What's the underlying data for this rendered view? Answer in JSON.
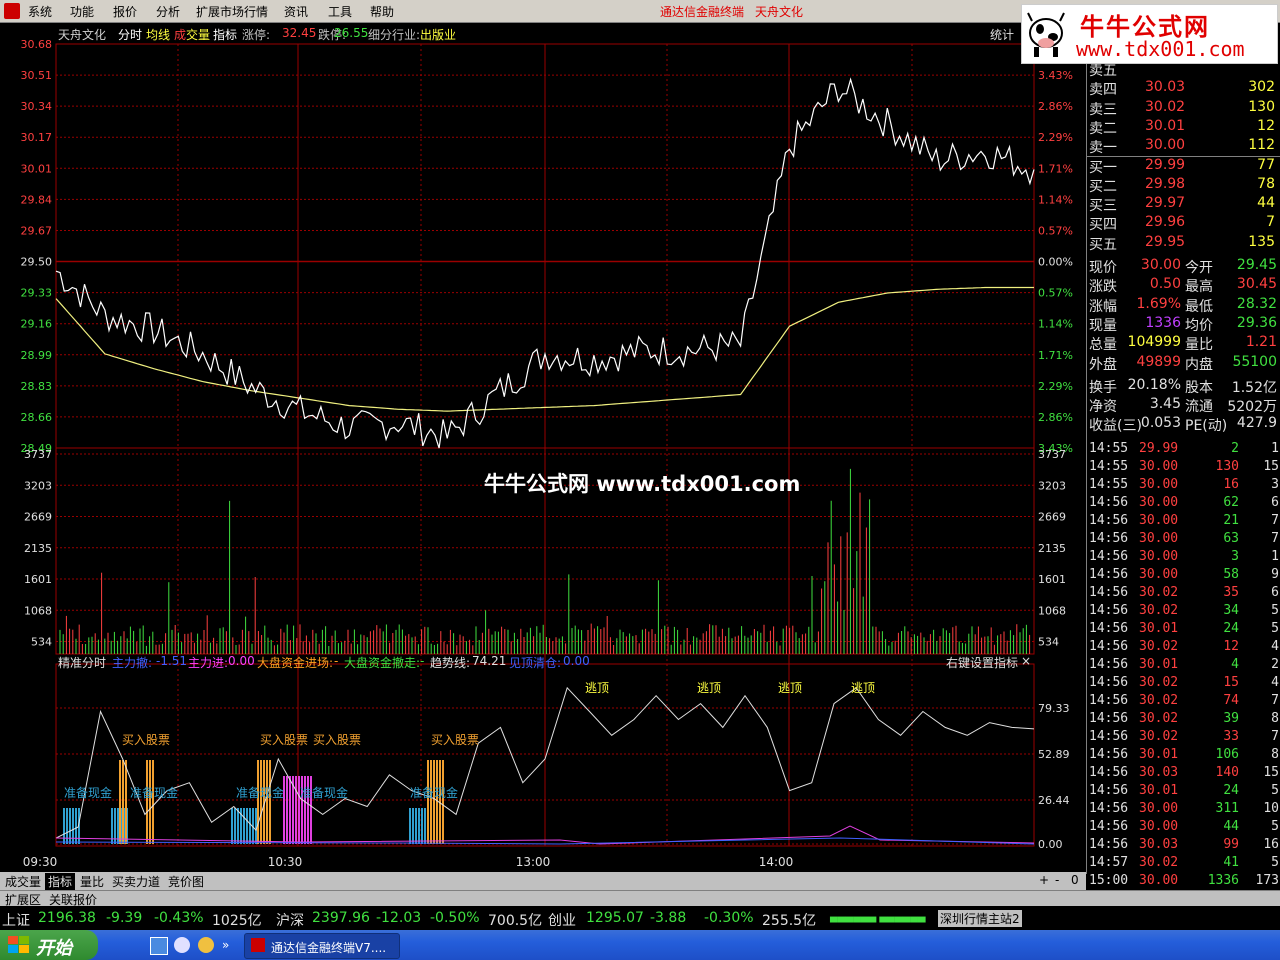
{
  "menu": {
    "items": [
      "系统",
      "功能",
      "报价",
      "分析",
      "扩展市场行情",
      "资讯",
      "工具",
      "帮助"
    ],
    "center_title": "通达信金融终端",
    "stock_name": "天舟文化"
  },
  "ad": {
    "brand": "牛牛公式网",
    "url": "www.tdx001.com"
  },
  "header": {
    "stock": "天舟文化",
    "tab_fenshi": "分时",
    "tab_junxian": "均线",
    "tab_cheng": "成",
    "tab_jiaoliang": "交量",
    "tab_zhibiao": "指标",
    "zhangting_label": "涨停:",
    "zhangting_value": "32.45",
    "dieting_label": "跌停:",
    "dieting_value": "26.55",
    "industry_label": "细分行业:",
    "industry_value": "出版业",
    "stats_button": "统计"
  },
  "colors": {
    "up": "#ff4040",
    "down": "#40e040",
    "grid": "#9a0000",
    "price_line": "#ffffff",
    "avg_line": "#f0f080",
    "yellow": "#ffff40"
  },
  "price_axis": {
    "left": [
      "30.68",
      "30.51",
      "30.34",
      "30.17",
      "30.01",
      "29.84",
      "29.67",
      "29.50",
      "29.33",
      "29.16",
      "28.99",
      "28.83",
      "28.66",
      "28.49"
    ],
    "right": [
      "3.43%",
      "2.86%",
      "2.29%",
      "1.71%",
      "1.14%",
      "0.57%",
      "0.00%",
      "0.57%",
      "1.14%",
      "1.71%",
      "2.29%",
      "2.86%",
      "3.43%"
    ]
  },
  "volume_axis": [
    "3737",
    "3203",
    "2669",
    "2135",
    "1601",
    "1068",
    "534"
  ],
  "indicator_header": {
    "name": "精准分时",
    "zlq_label": "主力撤:",
    "zlq_value": "-1.51",
    "zlj_label": "主力进:",
    "zlj_value": "0.00",
    "dpjc_label": "大盘资金进场:",
    "dpjc_value": "-",
    "dpcz_label": "大盘资金撤走:",
    "dpcz_value": "-",
    "qsx_label": "趋势线:",
    "qsx_value": "74.21",
    "jdqc_label": "见顶清仓:",
    "jdqc_value": "0.00",
    "settings": "右键设置指标",
    "close": "×"
  },
  "indicator_axis": [
    "79.33",
    "52.89",
    "26.44",
    "0.00"
  ],
  "signals": {
    "buy": "买入股票",
    "cash": "准备现金",
    "top": "逃顶"
  },
  "time_axis": [
    "09:30",
    "10:30",
    "13:00",
    "14:00"
  ],
  "chart_data": {
    "type": "line",
    "title": "",
    "x": [
      "09:30",
      "10:30",
      "13:00",
      "14:00",
      "15:00"
    ],
    "prev_close": 29.5,
    "ylim": [
      28.49,
      30.68
    ],
    "series": [
      {
        "name": "",
        "values": [
          29.45,
          29.21,
          29.13,
          29.0,
          28.82,
          28.69,
          28.6,
          28.63,
          28.55,
          28.78,
          29.0,
          28.97,
          29.02,
          29.02,
          29.05,
          30.12,
          30.45,
          30.25,
          30.05,
          30.1,
          30.0
        ]
      },
      {
        "name": "均线",
        "values": [
          29.3,
          29.0,
          28.92,
          28.85,
          28.8,
          28.76,
          28.72,
          28.7,
          28.69,
          28.7,
          28.71,
          28.72,
          28.74,
          28.76,
          28.78,
          29.15,
          29.28,
          29.33,
          29.35,
          29.36,
          29.36
        ]
      }
    ]
  },
  "right_panel": {
    "order_book": [
      {
        "label": "卖五",
        "price": "",
        "vol": ""
      },
      {
        "label": "卖四",
        "price": "30.03",
        "vol": "302"
      },
      {
        "label": "卖三",
        "price": "30.02",
        "vol": "130"
      },
      {
        "label": "卖二",
        "price": "30.01",
        "vol": "12"
      },
      {
        "label": "卖一",
        "price": "30.00",
        "vol": "112"
      },
      {
        "label": "买一",
        "price": "29.99",
        "vol": "77"
      },
      {
        "label": "买二",
        "price": "29.98",
        "vol": "78"
      },
      {
        "label": "买三",
        "price": "29.97",
        "vol": "44"
      },
      {
        "label": "买四",
        "price": "29.96",
        "vol": "7"
      },
      {
        "label": "买五",
        "price": "29.95",
        "vol": "135"
      }
    ],
    "quote": [
      {
        "l1": "现价",
        "v1": "30.00",
        "c1": "#ff4040",
        "l2": "今开",
        "v2": "29.45",
        "c2": "#40e040"
      },
      {
        "l1": "涨跌",
        "v1": "0.50",
        "c1": "#ff4040",
        "l2": "最高",
        "v2": "30.45",
        "c2": "#ff4040"
      },
      {
        "l1": "涨幅",
        "v1": "1.69%",
        "c1": "#ff4040",
        "l2": "最低",
        "v2": "28.32",
        "c2": "#40e040"
      },
      {
        "l1": "现量",
        "v1": "1336",
        "c1": "#c040ff",
        "l2": "均价",
        "v2": "29.36",
        "c2": "#40e040"
      },
      {
        "l1": "总量",
        "v1": "104999",
        "c1": "#ffff40",
        "l2": "量比",
        "v2": "1.21",
        "c2": "#ff4040"
      },
      {
        "l1": "外盘",
        "v1": "49899",
        "c1": "#ff4040",
        "l2": "内盘",
        "v2": "55100",
        "c2": "#40e040"
      }
    ],
    "fundamentals": [
      {
        "l1": "换手",
        "v1": "20.18%",
        "l2": "股本",
        "v2": "1.52亿"
      },
      {
        "l1": "净资",
        "v1": "3.45",
        "l2": "流通",
        "v2": "5202万"
      },
      {
        "l1": "收益(三)",
        "v1": "0.053",
        "l2": "PE(动)",
        "v2": "427.9"
      }
    ],
    "ticks": [
      {
        "t": "14:55",
        "p": "29.99",
        "v": "2",
        "n": "1",
        "up": false
      },
      {
        "t": "14:55",
        "p": "30.00",
        "v": "130",
        "n": "15",
        "up": true
      },
      {
        "t": "14:55",
        "p": "30.00",
        "v": "16",
        "n": "3",
        "up": true
      },
      {
        "t": "14:56",
        "p": "30.00",
        "v": "62",
        "n": "6",
        "up": false
      },
      {
        "t": "14:56",
        "p": "30.00",
        "v": "21",
        "n": "7",
        "up": false
      },
      {
        "t": "14:56",
        "p": "30.00",
        "v": "63",
        "n": "7",
        "up": false
      },
      {
        "t": "14:56",
        "p": "30.00",
        "v": "3",
        "n": "1",
        "up": false
      },
      {
        "t": "14:56",
        "p": "30.00",
        "v": "58",
        "n": "9",
        "up": false
      },
      {
        "t": "14:56",
        "p": "30.02",
        "v": "35",
        "n": "6",
        "up": true
      },
      {
        "t": "14:56",
        "p": "30.02",
        "v": "34",
        "n": "5",
        "up": false
      },
      {
        "t": "14:56",
        "p": "30.01",
        "v": "24",
        "n": "5",
        "up": false
      },
      {
        "t": "14:56",
        "p": "30.02",
        "v": "12",
        "n": "4",
        "up": true
      },
      {
        "t": "14:56",
        "p": "30.01",
        "v": "4",
        "n": "2",
        "up": false
      },
      {
        "t": "14:56",
        "p": "30.02",
        "v": "15",
        "n": "4",
        "up": true
      },
      {
        "t": "14:56",
        "p": "30.02",
        "v": "74",
        "n": "7",
        "up": true
      },
      {
        "t": "14:56",
        "p": "30.02",
        "v": "39",
        "n": "8",
        "up": false
      },
      {
        "t": "14:56",
        "p": "30.02",
        "v": "33",
        "n": "7",
        "up": true
      },
      {
        "t": "14:56",
        "p": "30.01",
        "v": "106",
        "n": "8",
        "up": false
      },
      {
        "t": "14:56",
        "p": "30.03",
        "v": "140",
        "n": "15",
        "up": true
      },
      {
        "t": "14:56",
        "p": "30.01",
        "v": "24",
        "n": "5",
        "up": false
      },
      {
        "t": "14:56",
        "p": "30.00",
        "v": "311",
        "n": "10",
        "up": false
      },
      {
        "t": "14:56",
        "p": "30.00",
        "v": "44",
        "n": "5",
        "up": false
      },
      {
        "t": "14:56",
        "p": "30.03",
        "v": "99",
        "n": "16",
        "up": true
      },
      {
        "t": "14:57",
        "p": "30.02",
        "v": "41",
        "n": "5",
        "up": false
      },
      {
        "t": "15:00",
        "p": "30.00",
        "v": "1336",
        "n": "173",
        "up": false
      }
    ]
  },
  "bottom_tabs": [
    "成交量",
    "指标",
    "量比",
    "买卖力道",
    "竞价图"
  ],
  "bottom_tabs2": [
    "扩展区",
    "关联报价"
  ],
  "status_bar": {
    "sh_name": "上证",
    "sh_val": "2196.38",
    "sh_chg": "-9.39",
    "sh_pct": "-0.43%",
    "sh_amt": "1025亿",
    "sz_name": "沪深",
    "sz_val": "2397.96",
    "sz_chg": "-12.03",
    "sz_pct": "-0.50%",
    "sz_amt": "700.5亿",
    "cy_name": "创业",
    "cy_val": "1295.07",
    "cy_chg": "-3.88",
    "cy_pct": "-0.30%",
    "cy_amt": "255.5亿",
    "server": "深圳行情主站2"
  },
  "taskbar": {
    "start": "开始",
    "app": "通达信金融终端V7...."
  },
  "watermark": "牛牛公式网 www.tdx001.com"
}
